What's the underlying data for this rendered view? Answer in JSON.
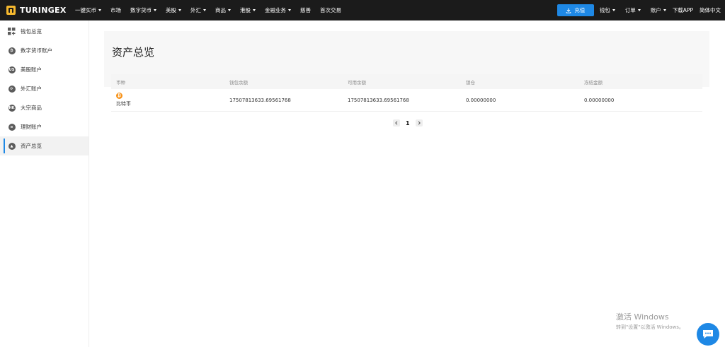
{
  "brand": {
    "name": "TURINGEX"
  },
  "nav": {
    "items": [
      {
        "label": "一键买币",
        "dropdown": true
      },
      {
        "label": "市场",
        "dropdown": false
      },
      {
        "label": "数字货币",
        "dropdown": true
      },
      {
        "label": "美股",
        "dropdown": true
      },
      {
        "label": "外汇",
        "dropdown": true
      },
      {
        "label": "商品",
        "dropdown": true
      },
      {
        "label": "港股",
        "dropdown": true
      },
      {
        "label": "金融业务",
        "dropdown": true
      },
      {
        "label": "慈善",
        "dropdown": false
      },
      {
        "label": "首次交易",
        "dropdown": false
      }
    ],
    "deposit_label": "充值",
    "right_items": [
      {
        "label": "钱包",
        "dropdown": true
      },
      {
        "label": "订单",
        "dropdown": true
      },
      {
        "label": "账户",
        "dropdown": true
      },
      {
        "label": "下载APP",
        "dropdown": false
      },
      {
        "label": "简体中文",
        "dropdown": false
      }
    ]
  },
  "sidebar": {
    "items": [
      {
        "label": "钱包总览",
        "icon": "grid-icon"
      },
      {
        "label": "数字货币账户",
        "icon": "crypto-icon"
      },
      {
        "label": "美股账户",
        "icon": "us-stock-icon"
      },
      {
        "label": "外汇账户",
        "icon": "forex-icon"
      },
      {
        "label": "大宗商品",
        "icon": "commodity-icon"
      },
      {
        "label": "理财账户",
        "icon": "finance-icon"
      },
      {
        "label": "资产总览",
        "icon": "assets-icon",
        "active": true
      }
    ]
  },
  "page": {
    "title": "资产总览"
  },
  "table": {
    "headers": [
      "币种",
      "钱包余额",
      "可用余额",
      "锁仓",
      "冻结金额"
    ],
    "rows": [
      {
        "coin": "比特币",
        "wallet_balance": "17507813633.69561768",
        "available": "17507813633.69561768",
        "locked": "0.00000000",
        "frozen": "0.00000000"
      }
    ]
  },
  "pagination": {
    "current": "1"
  },
  "watermark": {
    "title": "激活 Windows",
    "subtitle": "转到\"设置\"以激活 Windows。"
  },
  "colors": {
    "topbar": "#1b1b1b",
    "accent": "#1e88e5",
    "btc": "#f7931a",
    "logo": "#f5b82e"
  }
}
